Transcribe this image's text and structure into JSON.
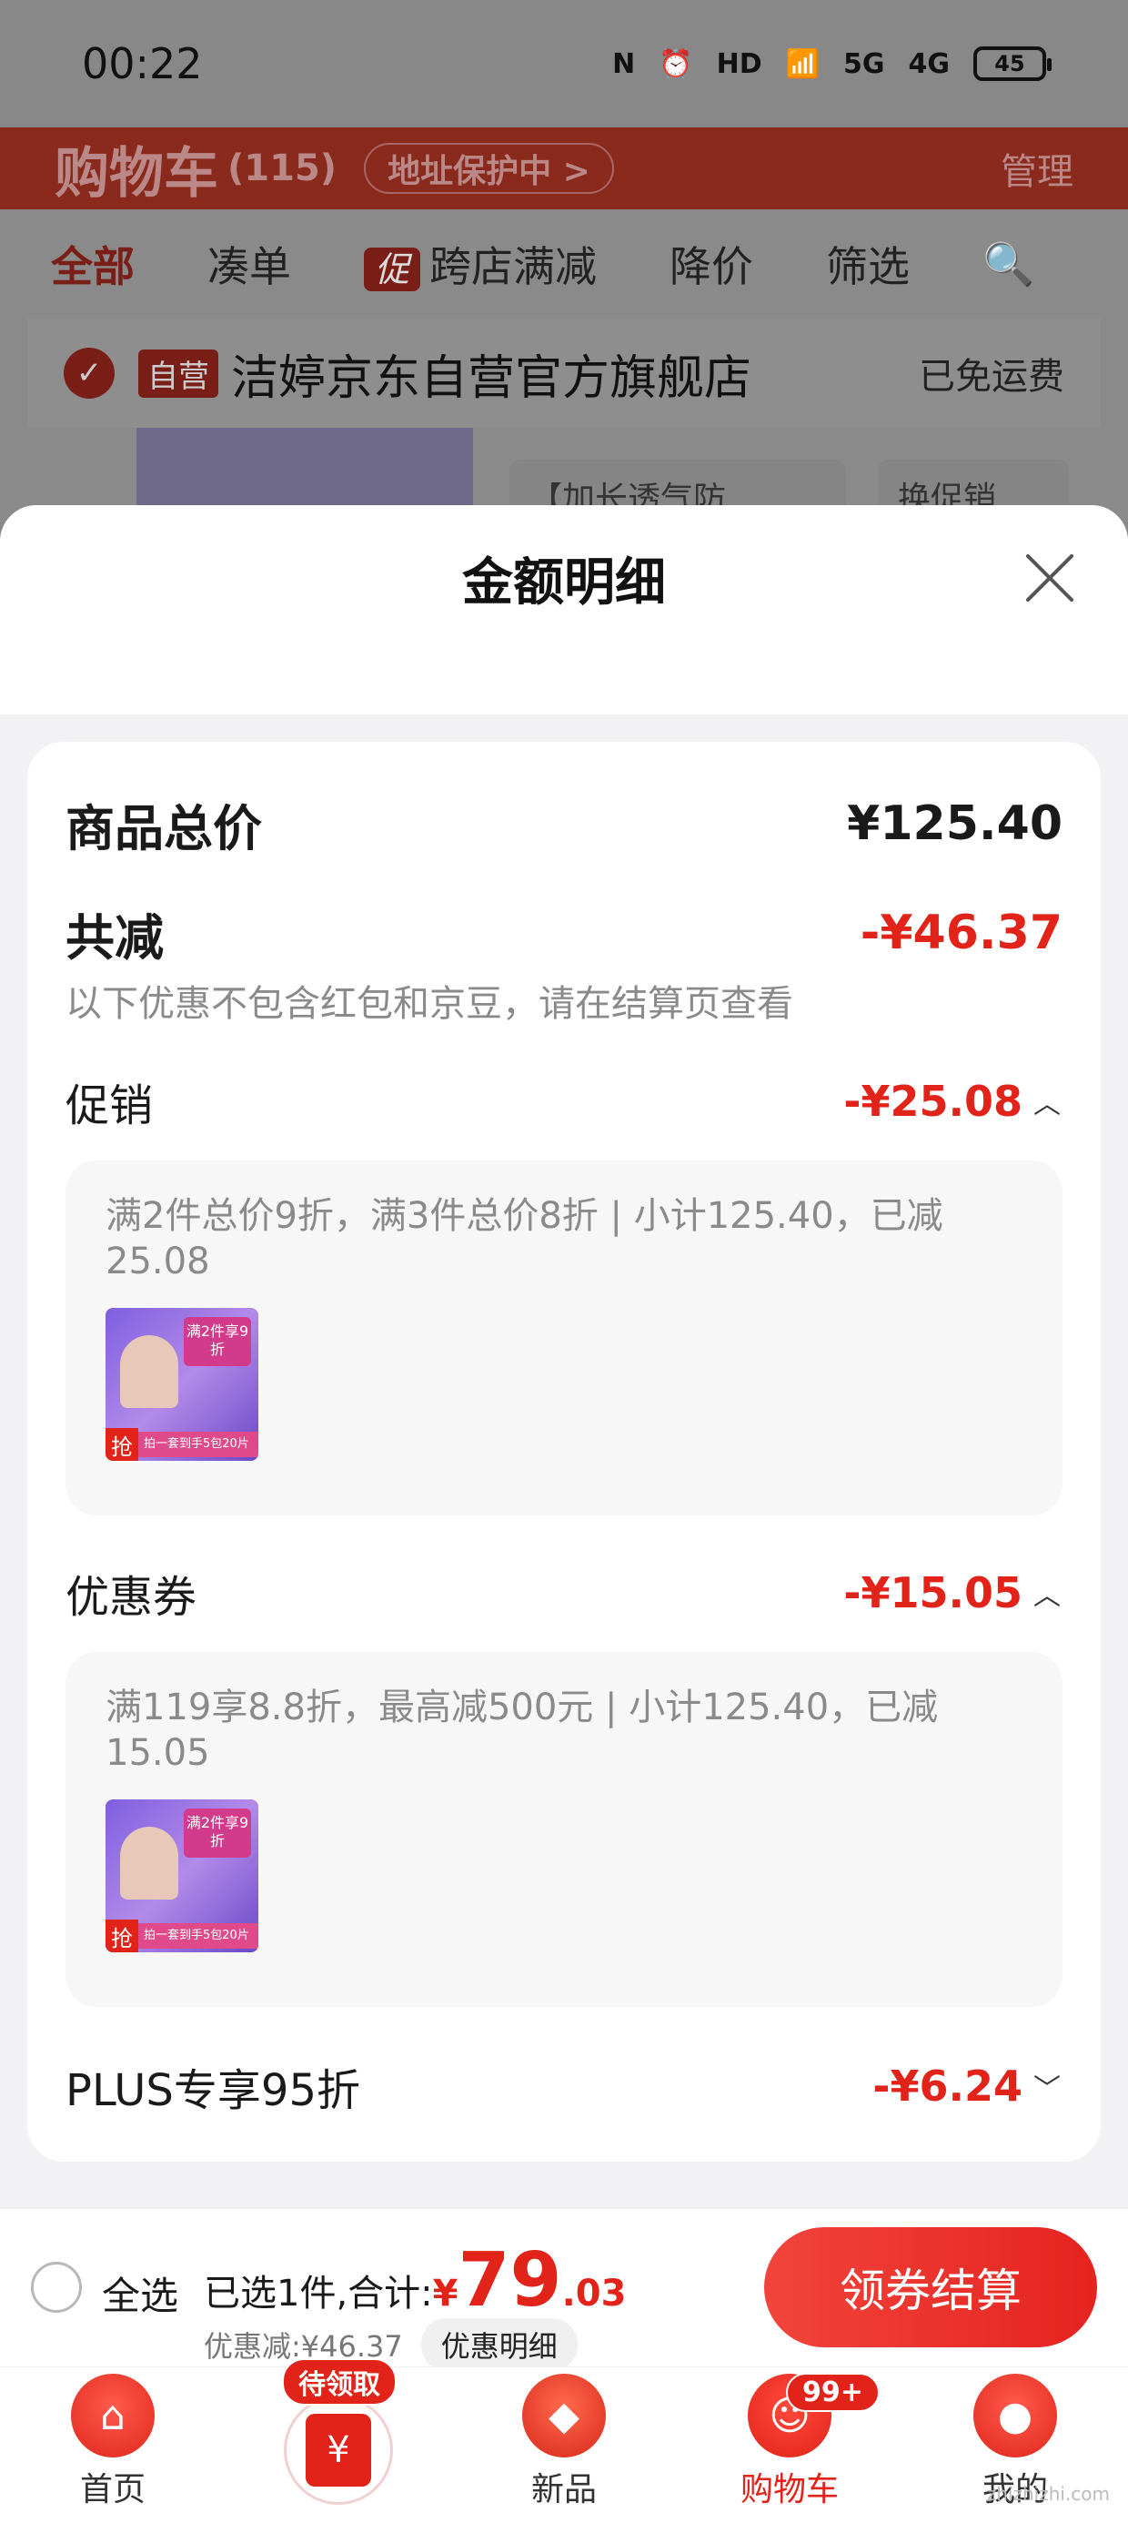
{
  "status_bar": {
    "time": "00:22",
    "icons": [
      "nfc-icon",
      "alarm-icon",
      "hd-icon",
      "wifi-icon",
      "5g-signal-icon",
      "4g-signal-icon"
    ],
    "hd_label": "HD",
    "signal_5g": "5G",
    "signal_4g": "4G",
    "battery": "45"
  },
  "background_page": {
    "title": "购物车",
    "count": "(115)",
    "address": "地址保护中 >",
    "manage": "管理",
    "tabs": [
      "全部",
      "凑单",
      "跨店满减",
      "降价",
      "筛选"
    ],
    "promo_tag": "促",
    "store_tag": "自营",
    "store_name": "洁婷京东自营官方旗舰店",
    "shipping": "已免运费",
    "chip_product": "【加长透气防",
    "chip_promo": "换促销"
  },
  "sheet": {
    "title": "金额明细",
    "total_label": "商品总价",
    "total_value": "¥125.40",
    "reduce_label": "共减",
    "reduce_value": "-¥46.37",
    "note": "以下优惠不包含红包和京豆，请在结算页查看",
    "sections": [
      {
        "label": "促销",
        "value": "-¥25.08",
        "expanded": true,
        "detail": "满2件总价9折，满3件总价8折 | 小计125.40，已减25.08"
      },
      {
        "label": "优惠券",
        "value": "-¥15.05",
        "expanded": true,
        "detail": "满119享8.8折，最高减500元 | 小计125.40，已减15.05"
      },
      {
        "label": "PLUS专享95折",
        "value": "-¥6.24",
        "expanded": false
      }
    ],
    "product_thumb": {
      "badge": "满2件享9折",
      "grab": "抢",
      "strip": "拍一套到手5包20片"
    }
  },
  "summary": {
    "select_all": "全选",
    "selected_label": "已选1件,合计:",
    "currency": "¥",
    "amount_int": "79",
    "amount_dec": ".03",
    "discount": "优惠减:¥46.37",
    "detail_button": "优惠明细",
    "checkout": "领券结算"
  },
  "bottom_nav": {
    "items": [
      {
        "label": "首页",
        "icon": "home-icon"
      },
      {
        "label": "",
        "icon": "coupon-icon",
        "badge": "待领取"
      },
      {
        "label": "新品",
        "icon": "new-products-icon"
      },
      {
        "label": "购物车",
        "icon": "cart-icon",
        "badge": "99+",
        "active": true
      },
      {
        "label": "我的",
        "icon": "profile-icon"
      }
    ]
  },
  "watermark": "zhizhizhi.com",
  "colors": {
    "accent": "#e2231a",
    "overlay": "#888888",
    "muted_text": "#8a8a8a"
  }
}
